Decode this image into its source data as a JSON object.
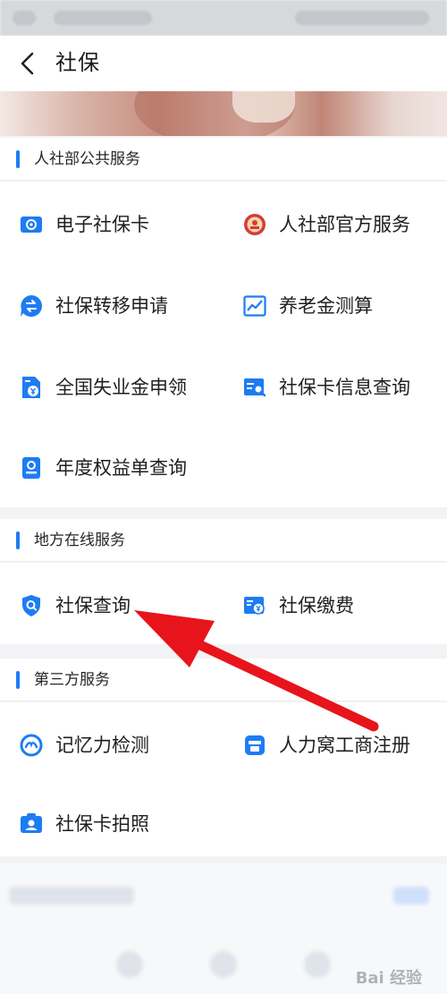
{
  "header": {
    "title": "社保"
  },
  "sections": [
    {
      "title": "人社部公共服务",
      "items": [
        {
          "label": "电子社保卡",
          "icon": "card-icon"
        },
        {
          "label": "人社部官方服务",
          "icon": "emblem-icon"
        },
        {
          "label": "社保转移申请",
          "icon": "transfer-icon"
        },
        {
          "label": "养老金测算",
          "icon": "chart-icon"
        },
        {
          "label": "全国失业金申领",
          "icon": "document-yuan-icon"
        },
        {
          "label": "社保卡信息查询",
          "icon": "card-search-icon"
        },
        {
          "label": "年度权益单查询",
          "icon": "report-icon"
        }
      ]
    },
    {
      "title": "地方在线服务",
      "items": [
        {
          "label": "社保查询",
          "icon": "shield-search-icon"
        },
        {
          "label": "社保缴费",
          "icon": "payment-icon"
        }
      ]
    },
    {
      "title": "第三方服务",
      "items": [
        {
          "label": "记忆力检测",
          "icon": "brain-icon"
        },
        {
          "label": "人力窝工商注册",
          "icon": "shop-icon"
        },
        {
          "label": "社保卡拍照",
          "icon": "photo-id-icon"
        }
      ]
    }
  ],
  "watermark": "Bai 经验",
  "colors": {
    "accent": "#1e7cf2",
    "arrow": "#e8141b"
  }
}
